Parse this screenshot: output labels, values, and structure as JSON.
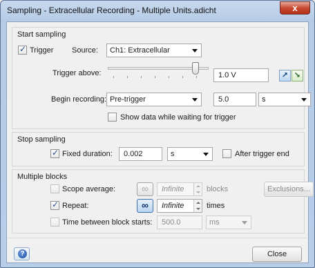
{
  "window": {
    "title": "Sampling - Extracellular Recording - Multiple Units.adicht",
    "close_glyph": "x"
  },
  "start_sampling": {
    "title": "Start sampling",
    "trigger_label": "Trigger",
    "trigger_checked": true,
    "source_label": "Source:",
    "source_value": "Ch1: Extracellular",
    "trigger_above_label": "Trigger above:",
    "trigger_above_value": "1.0 V",
    "trigger_level_fraction": 0.9,
    "begin_recording_label": "Begin recording:",
    "begin_recording_value": "Pre-trigger",
    "begin_recording_amount": "5.0",
    "begin_recording_unit": "s",
    "show_data_label": "Show data while waiting for trigger",
    "show_data_checked": false
  },
  "stop_sampling": {
    "title": "Stop sampling",
    "fixed_duration_label": "Fixed duration:",
    "fixed_duration_checked": true,
    "fixed_duration_value": "0.002",
    "fixed_duration_unit": "s",
    "after_trigger_label": "After trigger end",
    "after_trigger_checked": false
  },
  "multiple_blocks": {
    "title": "Multiple blocks",
    "scope_average_label": "Scope average:",
    "scope_average_checked": false,
    "scope_average_value": "Infinite",
    "scope_average_suffix": "blocks",
    "exclusions_label": "Exclusions...",
    "repeat_label": "Repeat:",
    "repeat_checked": true,
    "repeat_value": "Infinite",
    "repeat_suffix": "times",
    "time_between_label": "Time between block starts:",
    "time_between_checked": false,
    "time_between_value": "500.0",
    "time_between_unit": "ms",
    "loop_glyph": "∞"
  },
  "footer": {
    "help_glyph": "?",
    "close_label": "Close"
  },
  "icons": {
    "trigger_rising": "⭧",
    "trigger_falling": "⭨"
  }
}
